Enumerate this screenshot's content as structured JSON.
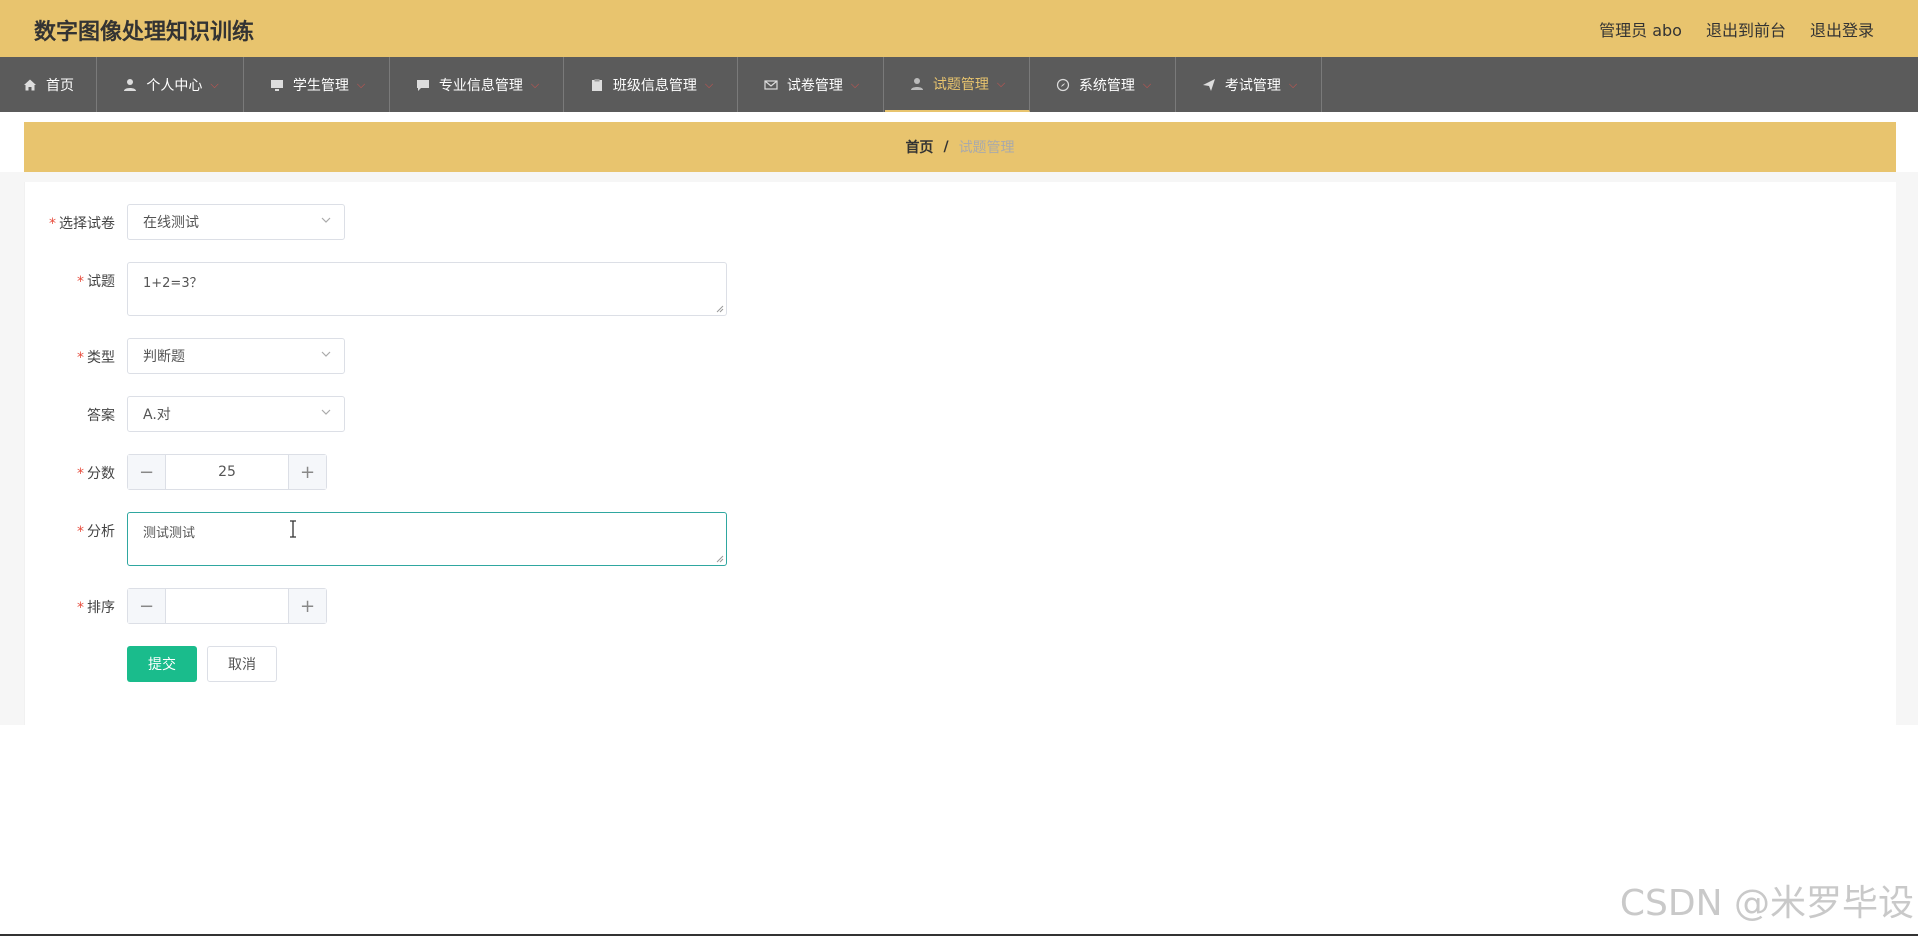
{
  "header": {
    "title": "数字图像处理知识训练",
    "user": "管理员 abo",
    "front_link": "退出到前台",
    "logout_link": "退出登录"
  },
  "nav": {
    "items": [
      {
        "label": "首页",
        "icon": "home-icon"
      },
      {
        "label": "个人中心",
        "icon": "user-icon"
      },
      {
        "label": "学生管理",
        "icon": "monitor-icon"
      },
      {
        "label": "专业信息管理",
        "icon": "chat-icon"
      },
      {
        "label": "班级信息管理",
        "icon": "clipboard-icon"
      },
      {
        "label": "试卷管理",
        "icon": "mail-icon"
      },
      {
        "label": "试题管理",
        "icon": "user-icon"
      },
      {
        "label": "系统管理",
        "icon": "compass-icon"
      },
      {
        "label": "考试管理",
        "icon": "send-icon"
      }
    ],
    "active": "试题管理"
  },
  "breadcrumb": {
    "home": "首页",
    "separator": "/",
    "current": "试题管理"
  },
  "form": {
    "paper_label": "选择试卷",
    "paper_value": "在线测试",
    "question_label": "试题",
    "question_value": "1+2=3？",
    "type_label": "类型",
    "type_value": "判断题",
    "answer_label": "答案",
    "answer_value": "A.对",
    "score_label": "分数",
    "score_value": "25",
    "analysis_label": "分析",
    "analysis_value": "测试测试",
    "order_label": "排序",
    "order_value": "",
    "submit_label": "提交",
    "cancel_label": "取消"
  },
  "watermark": "CSDN @米罗毕设",
  "colors": {
    "header_bg": "#e8c46e",
    "nav_bg": "#5b5b5b",
    "accent": "#1abc8c",
    "focus_border": "#2fa7a0"
  }
}
